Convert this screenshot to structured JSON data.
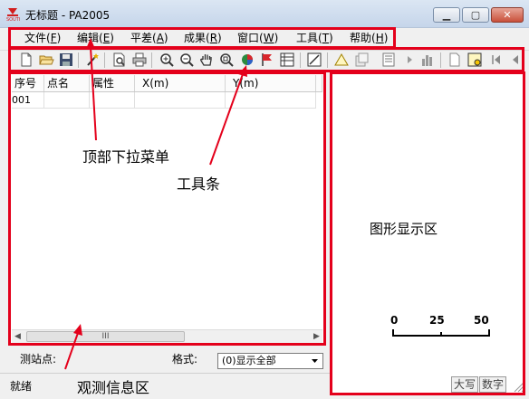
{
  "window": {
    "title": "无标题 - PA2005"
  },
  "menu": [
    {
      "label": "文件(",
      "key": "F",
      "tail": ")"
    },
    {
      "label": "编辑(",
      "key": "E",
      "tail": ")"
    },
    {
      "label": "平差(",
      "key": "A",
      "tail": ")"
    },
    {
      "label": "成果(",
      "key": "R",
      "tail": ")"
    },
    {
      "label": "窗口(",
      "key": "W",
      "tail": ")"
    },
    {
      "label": "工具(",
      "key": "T",
      "tail": ")"
    },
    {
      "label": "帮助(",
      "key": "H",
      "tail": ")"
    }
  ],
  "toolbar": {
    "icons": [
      "new-file-icon",
      "open-folder-icon",
      "save-icon",
      "magic-wand-icon",
      "print-preview-icon",
      "print-icon",
      "zoom-in-icon",
      "zoom-out-icon",
      "pan-hand-icon",
      "zoom-window-icon",
      "color-globe-icon",
      "flag-icon",
      "table-view-icon",
      "calculate-icon",
      "triangle-icon",
      "export-icon",
      "report-icon",
      "play-icon",
      "bar-chart-icon",
      "page-icon",
      "select-icon",
      "first-icon",
      "prev-icon"
    ]
  },
  "grid": {
    "columns": [
      "序号",
      "点名",
      "属性",
      "X(m)",
      "Y(m)"
    ],
    "rows": [
      [
        "001",
        "",
        "",
        "",
        ""
      ]
    ],
    "hscroll_thumb": "III"
  },
  "graphic": {
    "label": "图形显示区",
    "scale": [
      "0",
      "25",
      "50"
    ]
  },
  "bottom": {
    "station_label": "测站点:",
    "format_label": "格式:",
    "format_value": "(0)显示全部",
    "status": "就绪",
    "caps": "大写",
    "num": "数字"
  },
  "annotations": {
    "menu": "顶部下拉菜单",
    "toolbar": "工具条",
    "obs": "观测信息区"
  },
  "colors": {
    "annotation": "#e4001b"
  }
}
